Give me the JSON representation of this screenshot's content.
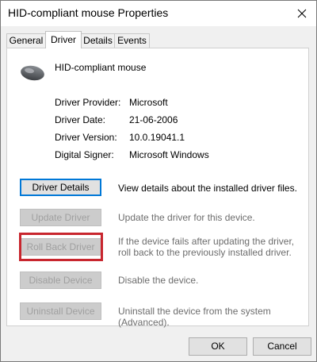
{
  "window": {
    "title": "HID-compliant mouse Properties"
  },
  "tabs": [
    {
      "label": "General",
      "active": false
    },
    {
      "label": "Driver",
      "active": true
    },
    {
      "label": "Details",
      "active": false
    },
    {
      "label": "Events",
      "active": false
    }
  ],
  "device": {
    "name": "HID-compliant mouse",
    "icon": "mouse-icon"
  },
  "info": [
    {
      "label": "Driver Provider:",
      "value": "Microsoft"
    },
    {
      "label": "Driver Date:",
      "value": "21-06-2006"
    },
    {
      "label": "Driver Version:",
      "value": "10.0.19041.1"
    },
    {
      "label": "Digital Signer:",
      "value": "Microsoft Windows"
    }
  ],
  "actions": [
    {
      "label": "Driver Details",
      "description": "View details about the installed driver files.",
      "enabled": true
    },
    {
      "label": "Update Driver",
      "description": "Update the driver for this device.",
      "enabled": false
    },
    {
      "label": "Roll Back Driver",
      "description": "If the device fails after updating the driver, roll back to the previously installed driver.",
      "enabled": false
    },
    {
      "label": "Disable Device",
      "description": "Disable the device.",
      "enabled": false
    },
    {
      "label": "Uninstall Device",
      "description": "Uninstall the device from the system (Advanced).",
      "enabled": false
    }
  ],
  "footer": {
    "ok_label": "OK",
    "cancel_label": "Cancel"
  },
  "colors": {
    "highlight": "#c8262e",
    "focus_border": "#0078d7"
  }
}
